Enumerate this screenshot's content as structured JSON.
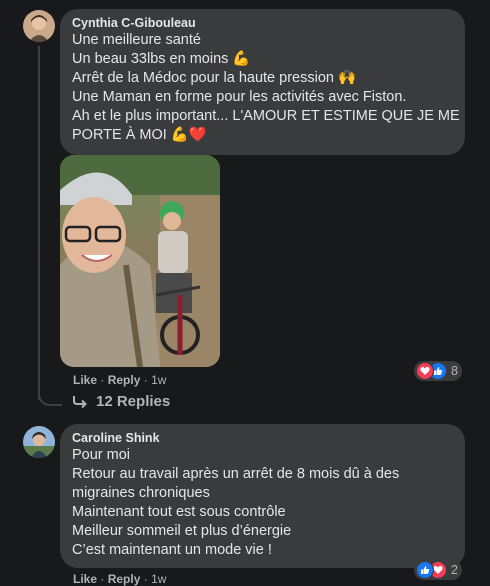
{
  "comments": [
    {
      "author": "Cynthia C-Gibouleau",
      "lines": [
        "Une meilleure santé",
        "Un beau 33lbs en moins 💪",
        "Arrêt de la Médoc pour la haute pression 🙌",
        "Une Maman en forme pour les activités avec Fiston.",
        "Ah et le plus important... L'AMOUR ET ESTIME QUE JE ME",
        "PORTE À MOI 💪❤️"
      ],
      "actions": {
        "like": "Like",
        "reply": "Reply",
        "time": "1w"
      },
      "reaction_count": "8"
    },
    {
      "author": "Caroline Shink",
      "lines": [
        "Pour moi",
        "Retour au travail après un arrêt de 8 mois dû à des",
        "migraines chroniques",
        "Maintenant tout est sous contrôle",
        "Meilleur sommeil et plus d’énergie",
        "C’est maintenant un mode vie !"
      ],
      "actions": {
        "like": "Like",
        "reply": "Reply",
        "time": "1w"
      },
      "reaction_count": "2"
    }
  ],
  "replies_link": "12 Replies",
  "colors": {
    "background": "#18191a",
    "bubble": "#3a3b3c",
    "text": "#e4e6eb",
    "secondary_text": "#b0b3b8",
    "heart": "#f33e58",
    "like": "#1877f2"
  },
  "icons": [
    "heart-reaction-icon",
    "like-reaction-icon",
    "reply-arrow-icon"
  ]
}
